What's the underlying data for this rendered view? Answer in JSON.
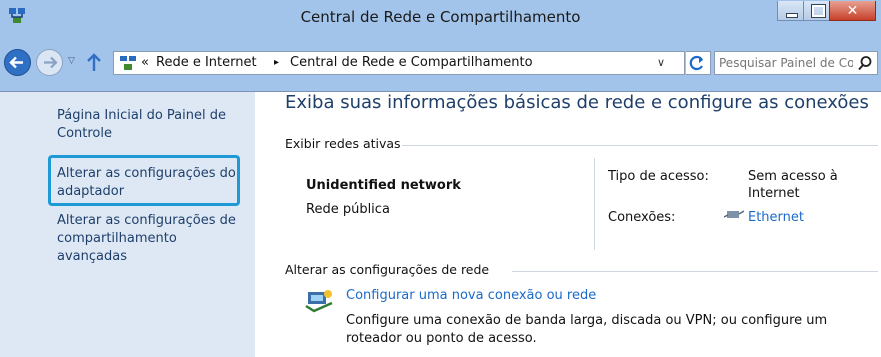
{
  "window": {
    "title": "Central de Rede e Compartilhamento"
  },
  "colors": {
    "accent": "#1d9ad6",
    "link": "#1b6ac9",
    "heading": "#1f3f6b",
    "chrome": "#a3c4ea",
    "sidebar": "#dde8f4"
  },
  "navigation": {
    "breadcrumb_prefix": "«",
    "breadcrumbs": [
      "Rede e Internet",
      "Central de Rede e Compartilhamento"
    ],
    "separator": "▸",
    "search_placeholder": "Pesquisar Painel de Co..."
  },
  "sidebar": {
    "items": [
      {
        "label": "Página Inicial do Painel de Controle"
      },
      {
        "label": "Alterar as configurações do adaptador"
      },
      {
        "label": "Alterar as configurações de compartilhamento avançadas"
      }
    ]
  },
  "main": {
    "heading": "Exiba suas informações básicas de rede e configure as conexões",
    "active_networks_label": "Exibir redes ativas",
    "network": {
      "name": "Unidentified network",
      "type": "Rede pública",
      "access_label": "Tipo de acesso:",
      "access_value": "Sem acesso à Internet",
      "connections_label": "Conexões:",
      "connections_value": "Ethernet"
    },
    "change_settings_label": "Alterar as configurações de rede",
    "tasks": [
      {
        "link": "Configurar uma nova conexão ou rede",
        "description": "Configure uma conexão de banda larga, discada ou VPN; ou configure um roteador ou ponto de acesso."
      }
    ]
  }
}
